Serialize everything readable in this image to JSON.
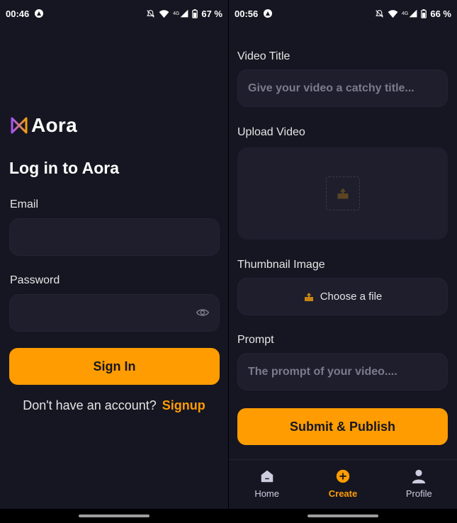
{
  "login": {
    "status": {
      "time": "00:46",
      "network": "4G",
      "battery": "67 %"
    },
    "logo_text": "Aora",
    "title": "Log in to Aora",
    "email_label": "Email",
    "email_value": "",
    "password_label": "Password",
    "password_value": "",
    "sign_in_label": "Sign In",
    "no_account_text": "Don't have an account?",
    "signup_link": "Signup"
  },
  "create": {
    "status": {
      "time": "00:56",
      "network": "4G",
      "battery": "66 %"
    },
    "video_title_label": "Video Title",
    "video_title_placeholder": "Give your video a catchy title...",
    "upload_video_label": "Upload Video",
    "thumbnail_label": "Thumbnail Image",
    "choose_file_label": "Choose a file",
    "prompt_label": "Prompt",
    "prompt_placeholder": "The prompt of your video....",
    "submit_label": "Submit & Publish",
    "tabs": [
      {
        "label": "Home",
        "icon": "home-icon"
      },
      {
        "label": "Create",
        "icon": "plus-circle-icon"
      },
      {
        "label": "Profile",
        "icon": "profile-icon"
      }
    ],
    "active_tab": "Create"
  },
  "colors": {
    "background": "#161622",
    "field": "#1e1e2d",
    "accent": "#ff9c01",
    "placeholder": "#7b7b8b",
    "logo_gradient_start": "#a855f7",
    "logo_gradient_end": "#f59e0b"
  }
}
